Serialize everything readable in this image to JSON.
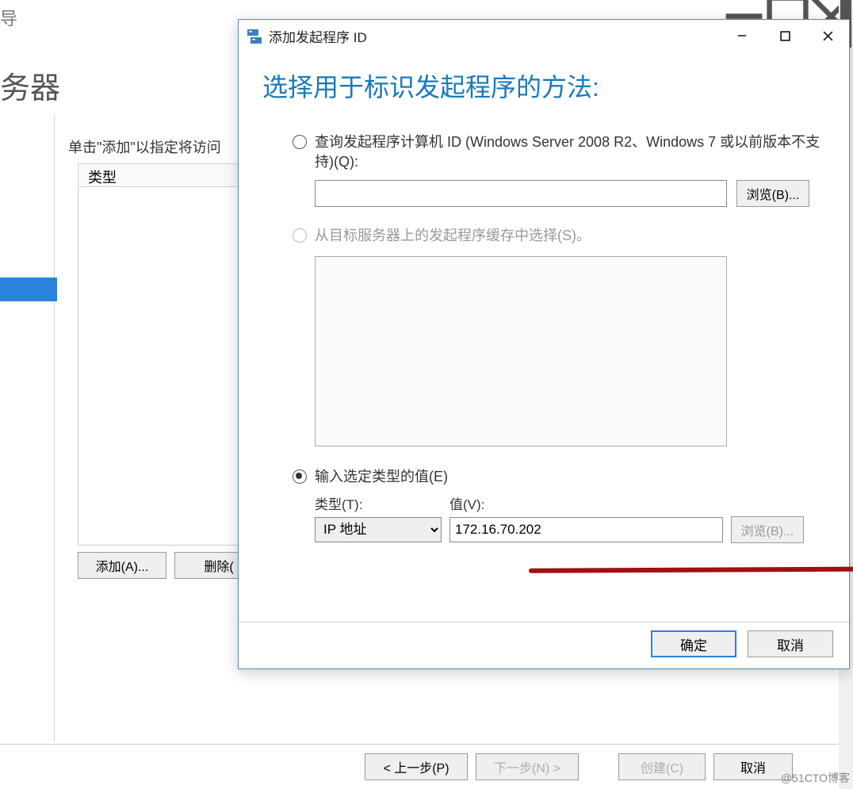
{
  "bg": {
    "title_char": "导",
    "heading_partial": "务器",
    "instruction": "单击\"添加\"以指定将访问",
    "list_header": "类型",
    "add_btn": "添加(A)...",
    "delete_btn": "删除(",
    "prev_btn": "< 上一步(P)",
    "next_btn": "下一步(N) >",
    "create_btn": "创建(C)",
    "cancel_btn": "取消"
  },
  "dialog": {
    "title": "添加发起程序 ID",
    "heading": "选择用于标识发起程序的方法:",
    "opt1": {
      "label": "查询发起程序计算机 ID (Windows Server 2008 R2、Windows 7 或以前版本不支持)(Q):",
      "browse": "浏览(B)..."
    },
    "opt2": {
      "label": "从目标服务器上的发起程序缓存中选择(S)。"
    },
    "opt3": {
      "label": "输入选定类型的值(E)",
      "type_label": "类型(T):",
      "value_label": "值(V):",
      "type_value": "IP 地址",
      "value_input": "172.16.70.202",
      "browse": "浏览(B)..."
    },
    "ok": "确定",
    "cancel": "取消"
  },
  "watermark": "@51CTO博客"
}
